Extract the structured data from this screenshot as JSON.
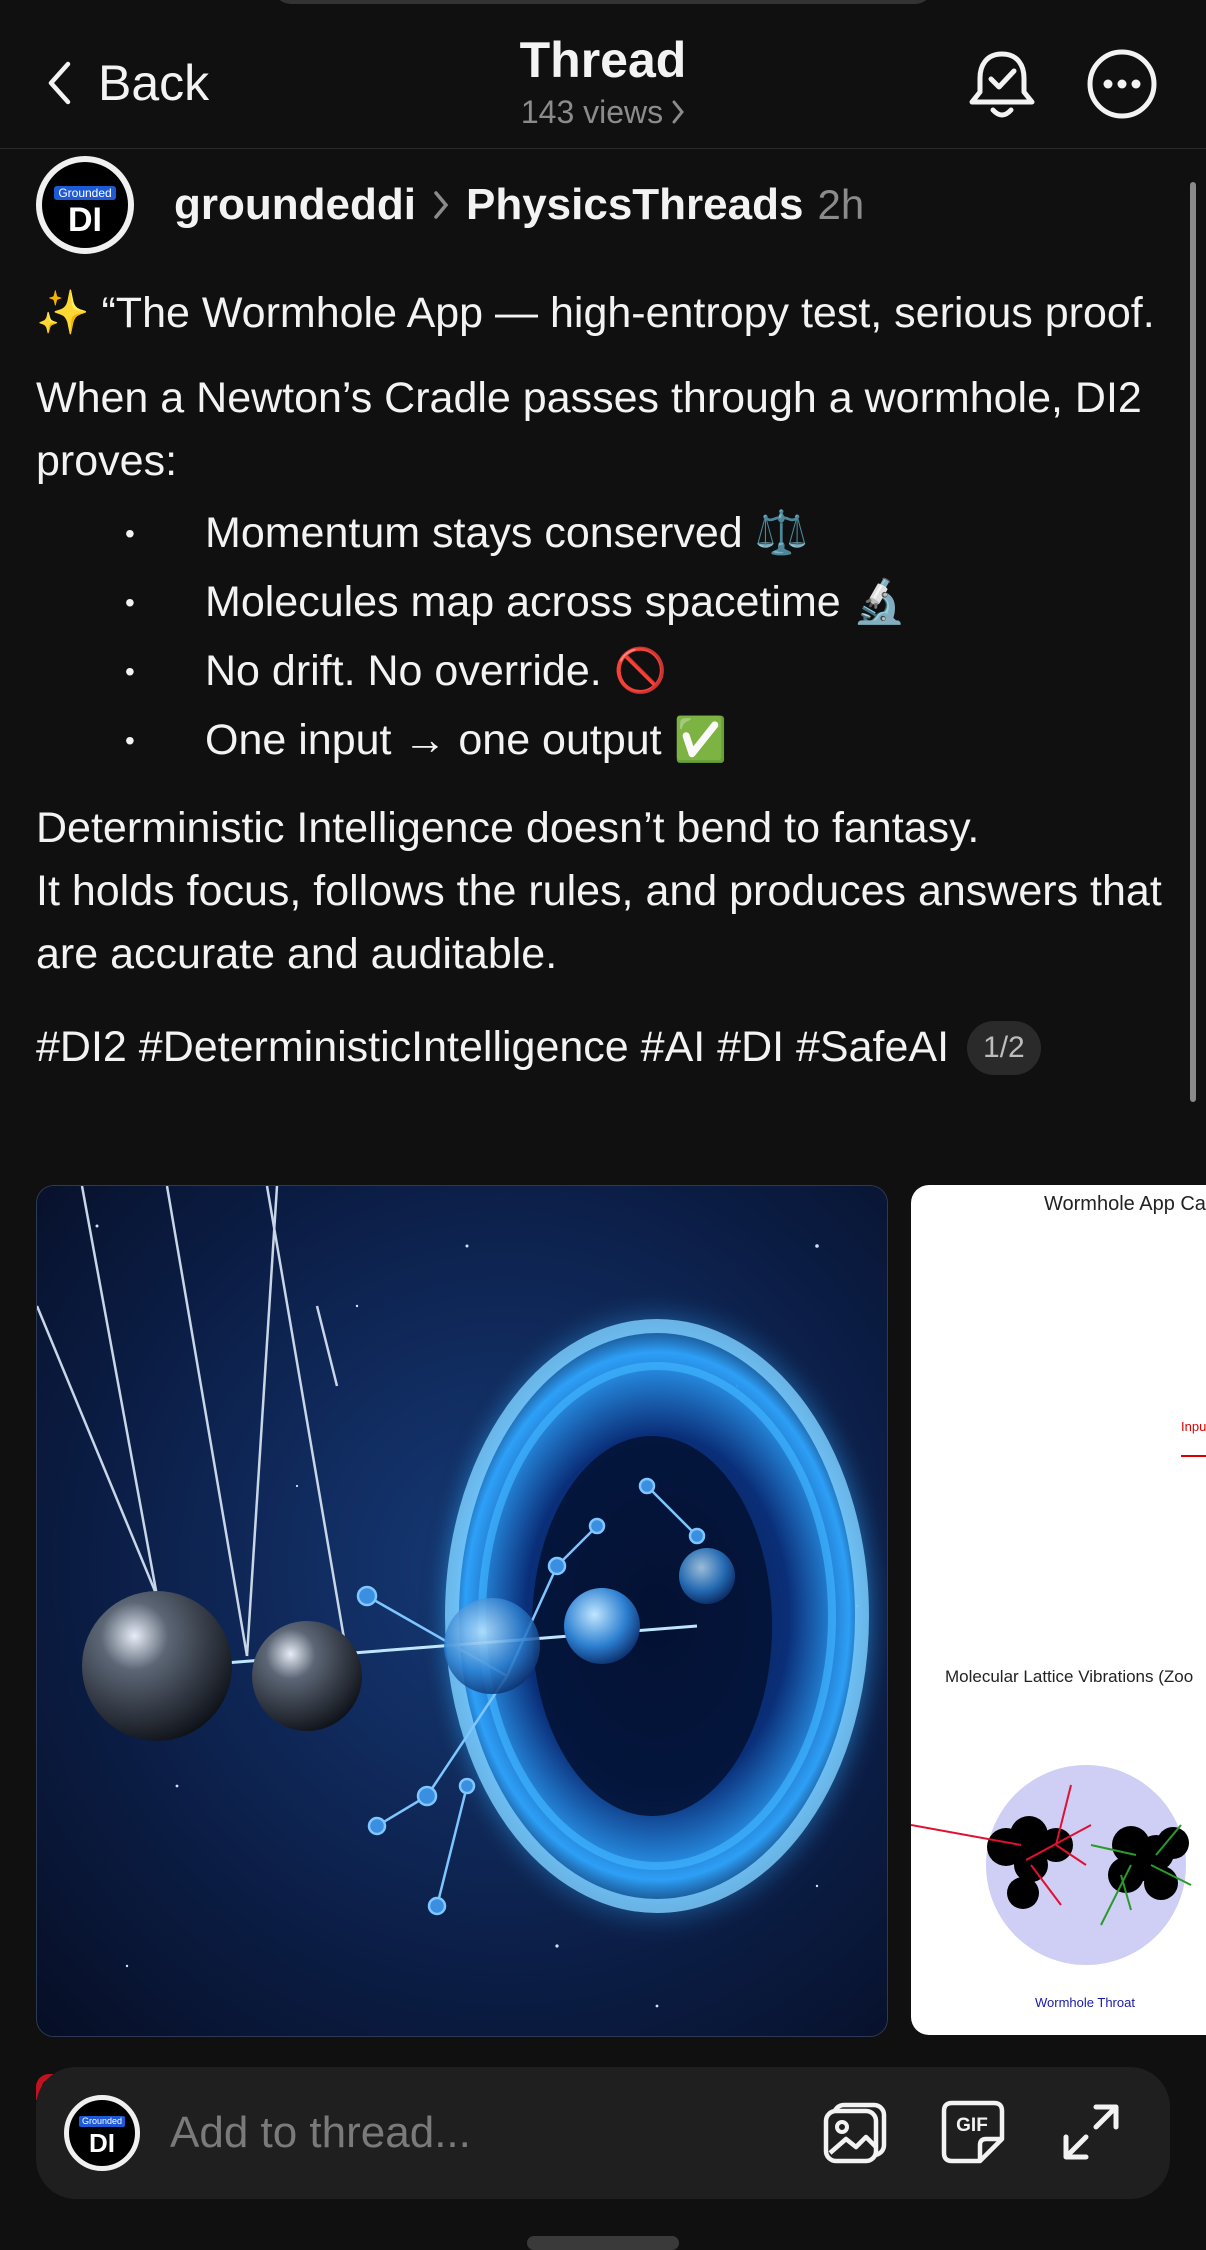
{
  "header": {
    "back_label": "Back",
    "title": "Thread",
    "views": "143 views"
  },
  "post": {
    "author": "groundeddi",
    "channel": "PhysicsThreads",
    "time": "2h",
    "avatar_badge": "Grounded",
    "avatar_initials": "DI",
    "intro": "✨ “The Wormhole App — high-entropy test, serious proof.",
    "lead": "When a Newton’s Cradle passes through a wormhole, DI2 proves:",
    "bullets": [
      "Momentum stays conserved ⚖️",
      "Molecules map across spacetime 🔬",
      "No drift. No override. 🚫",
      "One input → one output ✅"
    ],
    "line1": "Deterministic Intelligence doesn’t bend to fantasy.",
    "line2": "It holds focus, follows the rules, and produces answers that are accurate and auditable.",
    "hashtags": "#DI2 #DeterministicIntelligence #AI #DI #SafeAI",
    "media_pager": "1/2"
  },
  "media2": {
    "title": "Wormhole App Ca",
    "input_label": "Inpu",
    "subtitle": "Molecular Lattice Vibrations (Zoo",
    "throat_label": "Wormhole Throat"
  },
  "composer": {
    "placeholder": "Add to thread...",
    "gif_label": "GIF"
  },
  "colors": {
    "background": "#101010",
    "text": "#f3f3f3",
    "muted": "#8b8b8b",
    "accent_badge": "#1e5ad6"
  }
}
